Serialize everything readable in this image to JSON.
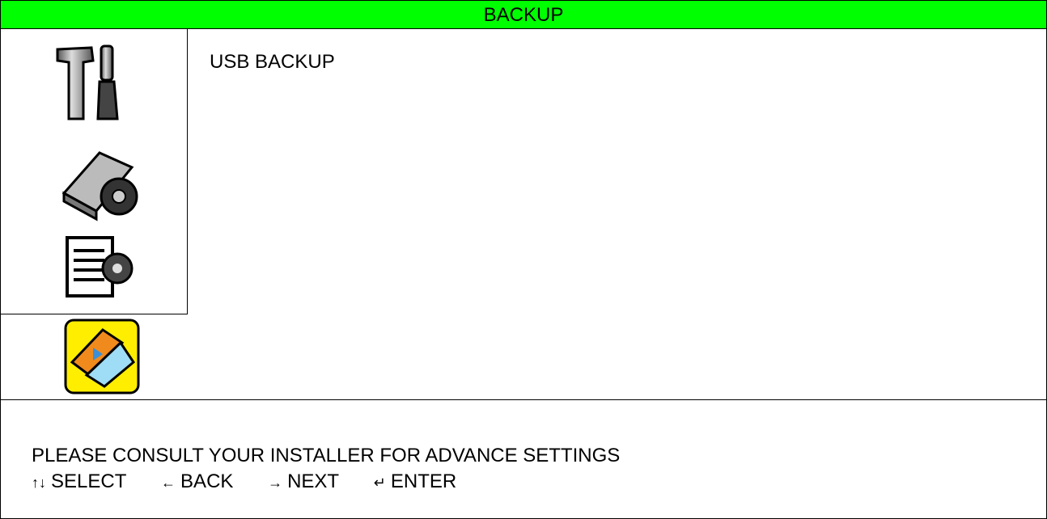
{
  "window": {
    "title": "BACKUP"
  },
  "sidebar": {
    "items": [
      {
        "icon": "tools-icon"
      },
      {
        "icon": "hdd-settings-icon"
      },
      {
        "icon": "document-settings-icon"
      },
      {
        "icon": "backup-icon",
        "selected": true
      }
    ]
  },
  "main": {
    "items": [
      {
        "label": "USB BACKUP"
      }
    ]
  },
  "footer": {
    "hint": "PLEASE CONSULT YOUR INSTALLER FOR ADVANCE SETTINGS",
    "keys": [
      {
        "glyph": "↑↓",
        "label": "SELECT"
      },
      {
        "glyph": "←",
        "label": "BACK"
      },
      {
        "glyph": "→",
        "label": "NEXT"
      },
      {
        "glyph": "↵",
        "label": "ENTER"
      }
    ]
  },
  "colors": {
    "title_bg": "#00ff00",
    "selected_bg": "#ffee00"
  }
}
